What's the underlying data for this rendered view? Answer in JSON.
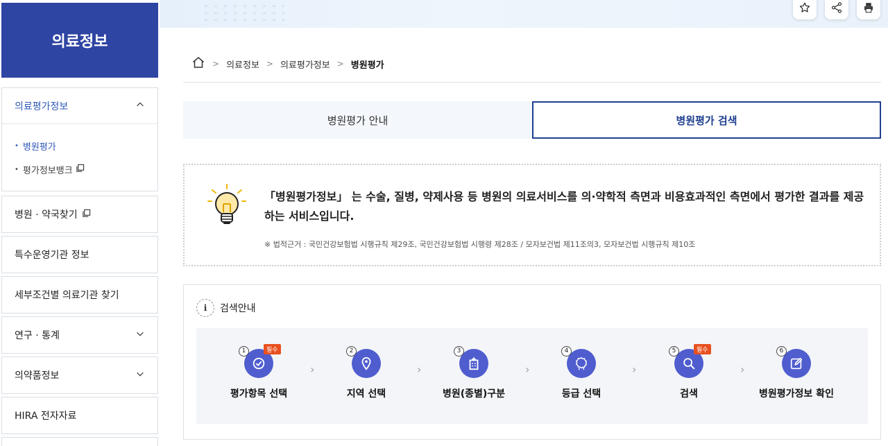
{
  "sidebar": {
    "title": "의료정보",
    "active_group": "의료평가정보",
    "sub_items": [
      {
        "label": "병원평가"
      },
      {
        "label": "평가정보뱅크"
      }
    ],
    "items": [
      {
        "label": "병원 · 약국찾기"
      },
      {
        "label": "특수운영기관 정보"
      },
      {
        "label": "세부조건별 의료기관 찾기"
      },
      {
        "label": "연구 · 통계"
      },
      {
        "label": "의약품정보"
      },
      {
        "label": "HIRA 전자자료"
      }
    ]
  },
  "toolbar": {
    "icons": [
      "star-icon",
      "share-icon",
      "print-icon"
    ]
  },
  "breadcrumb": [
    "의료정보",
    "의료평가정보",
    "병원평가"
  ],
  "tabs": [
    {
      "label": "병원평가 안내"
    },
    {
      "label": "병원평가 검색"
    }
  ],
  "info": {
    "text": "「병원평가정보」 는 수술, 질병, 약제사용 등 병원의 의료서비스를 의·약학적 측면과 비용효과적인 측면에서 평가한 결과를 제공하는 서비스입니다.",
    "note": "※ 법적근거 : 국민건강보험법 시행규칙 제29조, 국민건강보험법 시행령 제28조 / 모자보건법 제11조의3, 모자보건법 시행규칙 제10조"
  },
  "guide": {
    "title": "검색안내",
    "info_glyph": "i",
    "required_label": "필수",
    "steps": [
      {
        "num": "1",
        "label": "평가항목 선택",
        "icon": "check-icon"
      },
      {
        "num": "2",
        "label": "지역 선택",
        "icon": "location-pin-icon"
      },
      {
        "num": "3",
        "label": "병원(종별)구분",
        "icon": "hospital-building-icon"
      },
      {
        "num": "4",
        "label": "등급 선택",
        "icon": "badge-icon"
      },
      {
        "num": "5",
        "label": "검색",
        "icon": "search-icon"
      },
      {
        "num": "6",
        "label": "병원평가정보 확인",
        "icon": "edit-icon"
      }
    ]
  },
  "colors": {
    "brand": "#2f45a3",
    "tab_active_border": "#1f3f8f",
    "step_icon": "#4f5dcf",
    "required_badge": "#e8501f"
  }
}
